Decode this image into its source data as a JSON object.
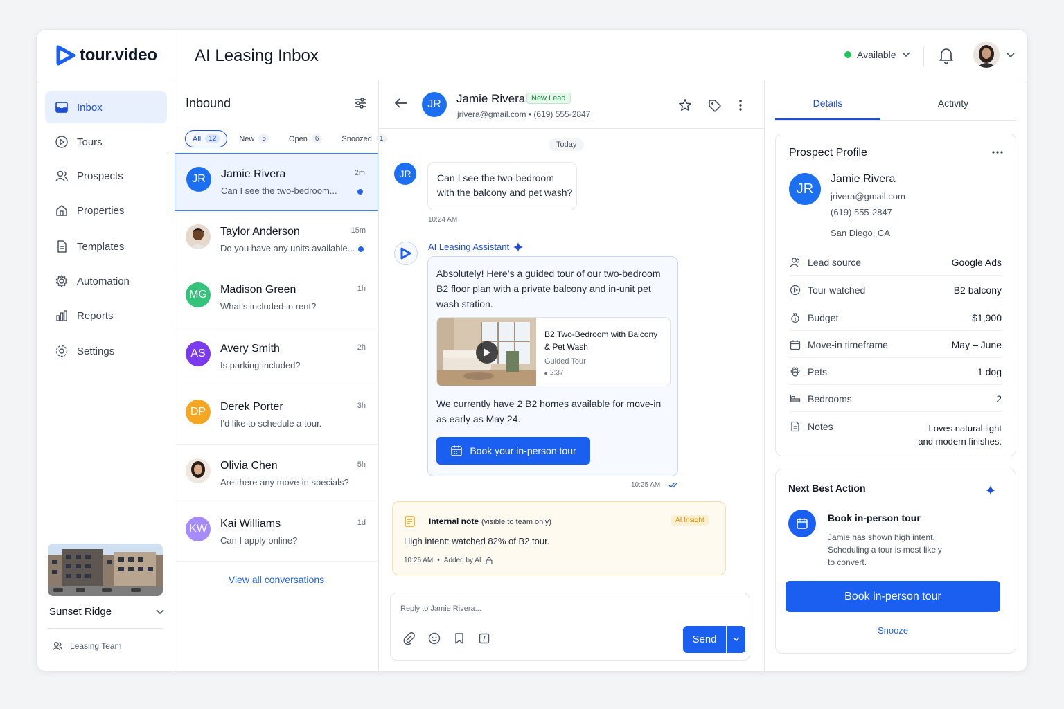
{
  "brand": {
    "name": "tour.video"
  },
  "header": {
    "title": "AI Leasing Inbox",
    "status": "Available"
  },
  "colors": {
    "accent": "#1a5ff0",
    "available": "#22c55e",
    "avatar_jr": "#1d6ff2",
    "avatar_mg": "#34c37a",
    "avatar_as": "#7c3aed",
    "avatar_dp": "#f5a623",
    "avatar_kw": "#a78bfa"
  },
  "sidebar": {
    "items": [
      {
        "label": "Inbox",
        "icon": "inbox-icon"
      },
      {
        "label": "Tours",
        "icon": "play-circle-icon"
      },
      {
        "label": "Prospects",
        "icon": "users-icon"
      },
      {
        "label": "Properties",
        "icon": "home-icon"
      },
      {
        "label": "Templates",
        "icon": "document-icon"
      },
      {
        "label": "Automation",
        "icon": "gear-icon"
      },
      {
        "label": "Reports",
        "icon": "bar-chart-icon"
      },
      {
        "label": "Settings",
        "icon": "settings-icon"
      }
    ],
    "property": "Sunset Ridge",
    "team": "Leasing Team"
  },
  "inbound": {
    "title": "Inbound",
    "filters": [
      {
        "label": "All",
        "count": "12"
      },
      {
        "label": "New",
        "count": "5"
      },
      {
        "label": "Open",
        "count": "6"
      },
      {
        "label": "Snoozed",
        "count": "1"
      }
    ],
    "conversations": [
      {
        "initials": "JR",
        "name": "Jamie Rivera",
        "preview": "Can I see the two-bedroom...",
        "time": "2m"
      },
      {
        "initials": "",
        "name": "Taylor Anderson",
        "preview": "Do you have any units available...",
        "time": "15m"
      },
      {
        "initials": "MG",
        "name": "Madison Green",
        "preview": "What's included in rent?",
        "time": "1h"
      },
      {
        "initials": "AS",
        "name": "Avery Smith",
        "preview": "Is parking included?",
        "time": "2h"
      },
      {
        "initials": "DP",
        "name": "Derek Porter",
        "preview": "I'd like to schedule a tour.",
        "time": "3h"
      },
      {
        "initials": "",
        "name": "Olivia Chen",
        "preview": "Are there any move-in specials?",
        "time": "5h"
      },
      {
        "initials": "KW",
        "name": "Kai Williams",
        "preview": "Can I apply online?",
        "time": "1d"
      }
    ],
    "view_all": "View all conversations"
  },
  "chat": {
    "contact": {
      "initials": "JR",
      "name": "Jamie Rivera",
      "badge": "New Lead",
      "meta": "jrivera@gmail.com • (619) 555-2847"
    },
    "day": "Today",
    "incoming": {
      "initials": "JR",
      "line1": "Can I see the two-bedroom",
      "line2": "with the balcony and pet wash?",
      "time": "10:24 AM"
    },
    "assistant": {
      "label": "AI Leasing Assistant",
      "line1": "Absolutely! Here’s a guided tour of our two-bedroom",
      "line2": "B2 floor plan with a private balcony and in-unit pet",
      "line3": "wash station.",
      "tour_title1": "B2 Two-Bedroom with Balcony",
      "tour_title2": "& Pet Wash",
      "tour_type": "Guided Tour",
      "tour_duration": "2:37",
      "avail1": "We currently have 2 B2 homes available for move-in",
      "avail2": "as early as May 24.",
      "cta": "Book your in-person tour",
      "time": "10:25 AM"
    },
    "note": {
      "title": "Internal note",
      "visibility": "(visible to team only)",
      "tag": "AI Insight",
      "body": "High intent: watched 82% of B2 tour.",
      "time": "10:26 AM",
      "added": "Added by AI"
    },
    "reply": {
      "placeholder": "Reply to Jamie Rivera...",
      "send": "Send"
    }
  },
  "details": {
    "tabs": [
      "Details",
      "Activity"
    ],
    "profile_title": "Prospect Profile",
    "initials": "JR",
    "name": "Jamie Rivera",
    "email": "jrivera@gmail.com",
    "phone": "(619) 555-2847",
    "location": "San Diego, CA",
    "fields": [
      {
        "label": "Lead source",
        "value": "Google Ads"
      },
      {
        "label": "Tour watched",
        "value": "B2 balcony"
      },
      {
        "label": "Budget",
        "value": "$1,900"
      },
      {
        "label": "Move-in timeframe",
        "value": "May – June"
      },
      {
        "label": "Pets",
        "value": "1 dog"
      },
      {
        "label": "Bedrooms",
        "value": "2"
      },
      {
        "label": "Notes",
        "value1": "Loves natural light",
        "value2": "and modern finishes."
      }
    ],
    "nba": {
      "title": "Next Best Action",
      "action": "Book in-person tour",
      "desc1": "Jamie has shown high intent.",
      "desc2": "Scheduling a tour is most likely",
      "desc3": "to convert.",
      "cta": "Book in-person tour",
      "snooze": "Snooze"
    }
  }
}
